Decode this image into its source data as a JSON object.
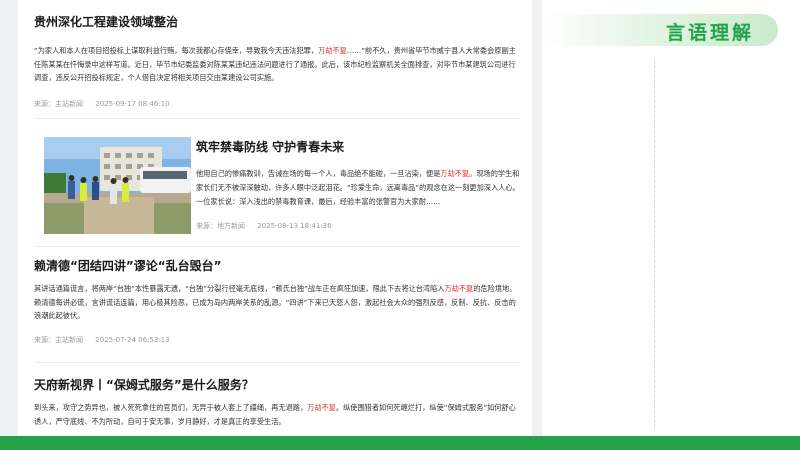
{
  "articles": [
    {
      "title": "贵州深化工程建设领域整治",
      "body_pre": "“为家人和本人在项目招投标上谋取利益行贿，每次我都心存侥幸，导致我今天违法犯罪，",
      "highlight": "万劫不复",
      "body_post": "……”前不久，贵州省毕节市威宁县人大常委会原副主任陈某某在忏悔录中这样写道。近日，毕节市纪委监委对陈某某违纪违法问题进行了通报。此后，该市纪检监察机关全面排查，对毕节市某建筑公司进行调查，违反公开招投标规定，个人借自决定将相关项目交由某建设公司实施。",
      "source": "来源：主站新闻",
      "date": "2025-09-17 08:46:10"
    },
    {
      "title": "筑牢禁毒防线 守护青春未来",
      "body_pre": "他用自己的惨痛教训，告诫在场的每一个人，毒品绝不能碰，一旦沾染，便是",
      "highlight": "万劫不复",
      "body_post": "。现场的学生和家长们无不被深深触动，许多人眼中泛起泪花。“珍爱生命，远离毒品”的观念在这一刻更加深入人心。一位家长说：深入浅出的禁毒教育课，最后，经验丰富的张警官为大家耐……",
      "source": "来源：地方新闻",
      "date": "2025-08-13 18:41:36"
    },
    {
      "title": "赖清德“团结四讲”谬论“乱台毁台”",
      "body_pre": "其讲话通篇谎言，将两岸“台独”本性暴露无遗，“台独”分裂行径毫无底线，“赖氏台独”战车正在疯狂加速，限此下去将让台湾陷入",
      "highlight": "万劫不复",
      "body_post": "的危险境地。 赖清德每讲必谎，言讲谎话连篇，用心极其险恶，已成为岛内两岸关系的乱源。“四讲”下来已天怒人怨，激起社会大众的强烈反感，反制、反抗、反击的浪潮此起彼伏。",
      "source": "来源：主站新闻",
      "date": "2025-07-24 06:53:13"
    },
    {
      "title": "天府新视界丨“保姆式服务”是什么服务？",
      "body_pre": "到头来，攻守之势异也，被人死死拿住的官员们，无异于被人套上了缰绳，再无退路，",
      "highlight": "万劫不复",
      "body_post": "。纵使围猎者如何死缠烂打，纵使“保姆式服务”如何舒心诱人，严守底线、不为所动，自可于安无事，岁月静好，才是真正的享受生活。",
      "source": "",
      "date": ""
    }
  ],
  "side": {
    "title": "言语理解"
  },
  "colors": {
    "accent_green": "#23a347",
    "highlight_red": "#e0312b"
  }
}
